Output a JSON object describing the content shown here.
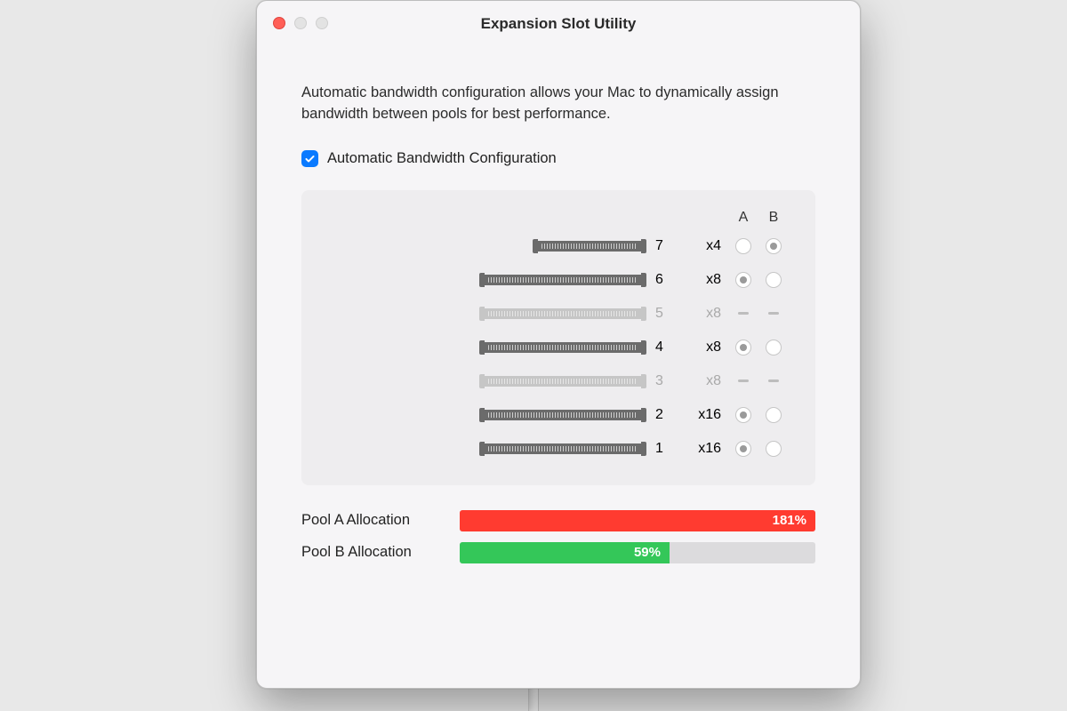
{
  "window": {
    "title": "Expansion Slot Utility"
  },
  "description": "Automatic bandwidth configuration allows your Mac to dynamically assign bandwidth between pools for best performance.",
  "checkbox": {
    "label": "Automatic Bandwidth Configuration",
    "checked": true
  },
  "columns": {
    "a": "A",
    "b": "B"
  },
  "slots": [
    {
      "num": "7",
      "lanes": "x4",
      "short": true,
      "disabled": false,
      "a": "unselected",
      "b": "selected"
    },
    {
      "num": "6",
      "lanes": "x8",
      "short": false,
      "disabled": false,
      "a": "selected",
      "b": "unselected"
    },
    {
      "num": "5",
      "lanes": "x8",
      "short": false,
      "disabled": true,
      "a": "dash",
      "b": "dash"
    },
    {
      "num": "4",
      "lanes": "x8",
      "short": false,
      "disabled": false,
      "a": "selected",
      "b": "unselected"
    },
    {
      "num": "3",
      "lanes": "x8",
      "short": false,
      "disabled": true,
      "a": "dash",
      "b": "dash"
    },
    {
      "num": "2",
      "lanes": "x16",
      "short": false,
      "disabled": false,
      "a": "selected",
      "b": "unselected"
    },
    {
      "num": "1",
      "lanes": "x16",
      "short": false,
      "disabled": false,
      "a": "selected",
      "b": "unselected"
    }
  ],
  "pools": {
    "a": {
      "label": "Pool A Allocation",
      "text": "181%",
      "percent": 100,
      "color": "red"
    },
    "b": {
      "label": "Pool B Allocation",
      "text": "59%",
      "percent": 59,
      "color": "green"
    }
  }
}
